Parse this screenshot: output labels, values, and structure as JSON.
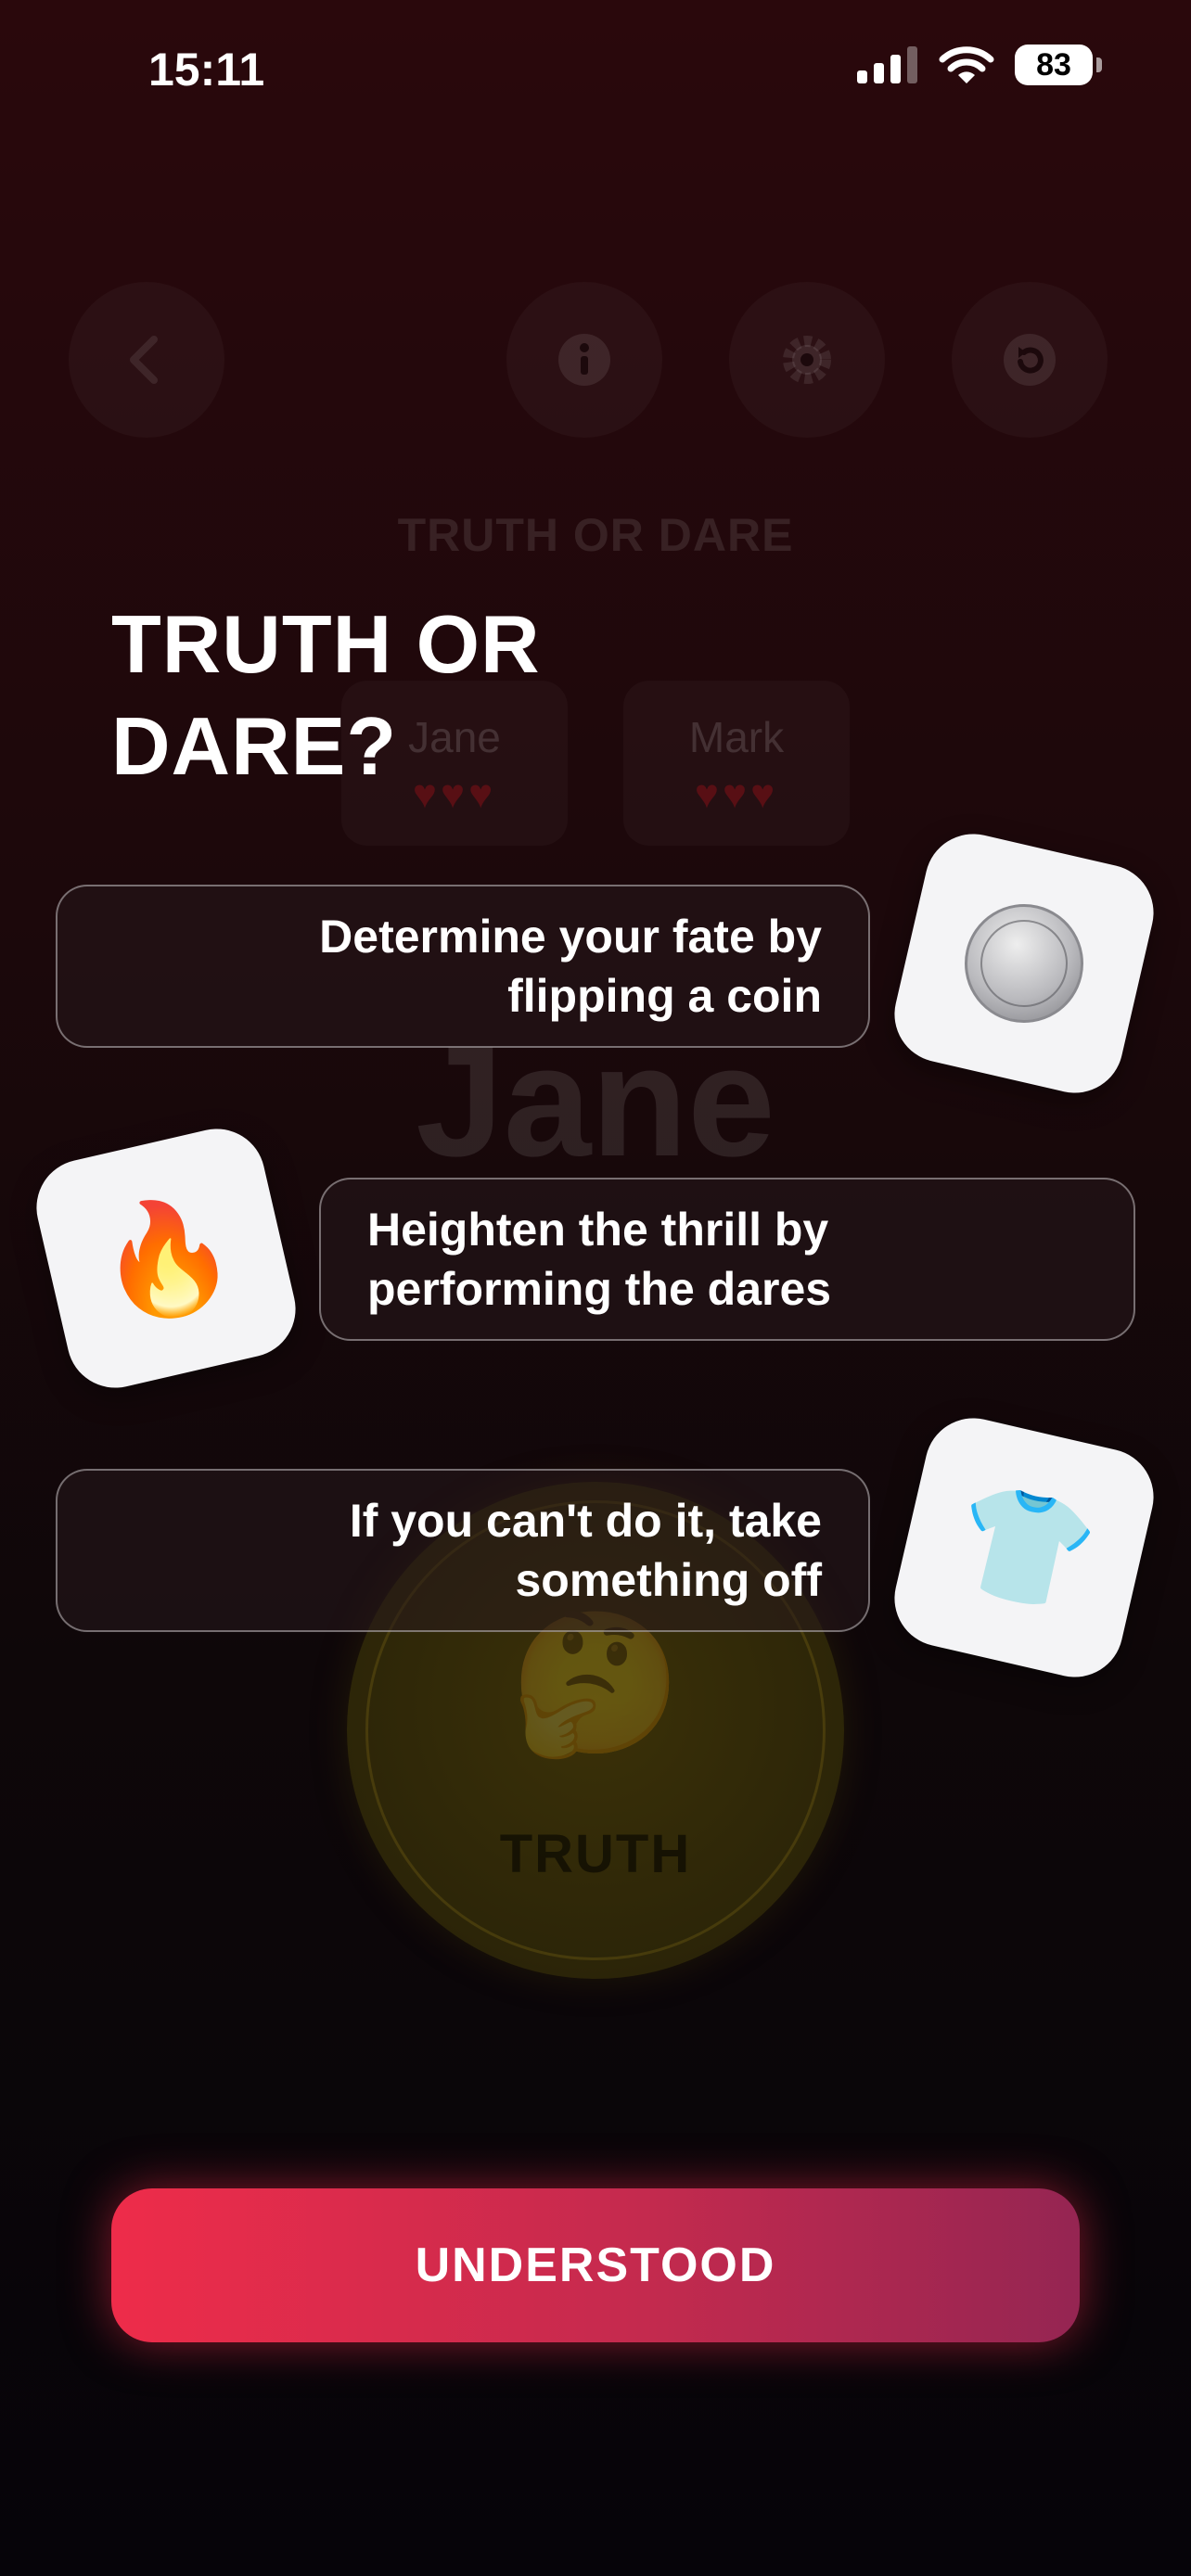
{
  "status_bar": {
    "time": "15:11",
    "battery": "83"
  },
  "background_screen": {
    "title": "TRUTH OR DARE",
    "players": [
      {
        "name": "Jane",
        "hearts": "♥♥♥"
      },
      {
        "name": "Mark",
        "hearts": "♥♥♥"
      }
    ],
    "current_player": "Jane",
    "coin": {
      "emoji": "🤔",
      "label": "TRUTH"
    }
  },
  "overlay": {
    "headline_line1": "TRUTH OR",
    "headline_line2": "DARE?",
    "rules": [
      {
        "text_line1": "Determine your fate by",
        "text_line2": "flipping a coin",
        "icon": "coin-icon"
      },
      {
        "text_line1": "Heighten the thrill by",
        "text_line2": "performing the dares",
        "icon": "fire-icon",
        "emoji": "🔥"
      },
      {
        "text_line1": "If you can't do it, take",
        "text_line2": "something off",
        "icon": "shirt-icon",
        "emoji": "👕"
      }
    ],
    "cta_label": "UNDERSTOOD"
  },
  "colors": {
    "accent_start": "#ee2c4a",
    "accent_end": "#952552",
    "background_top": "#2a080c",
    "background_bottom": "#060409"
  }
}
